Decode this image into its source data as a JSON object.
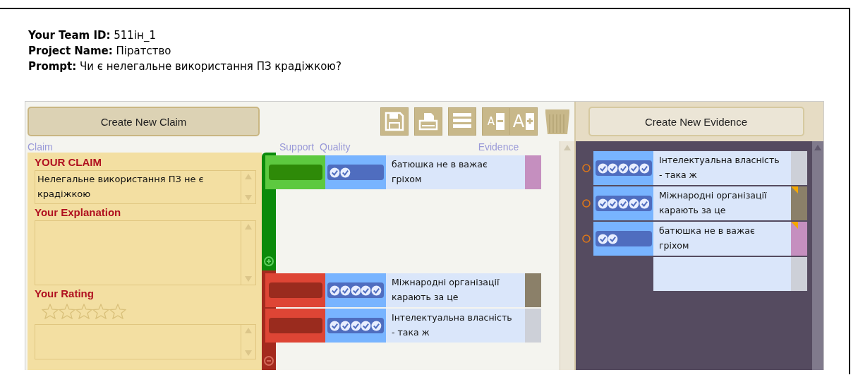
{
  "header": [
    {
      "label": "Your Team ID:",
      "value": "511ін_1"
    },
    {
      "label": "Project Name:",
      "value": "Піратство"
    },
    {
      "label": "Prompt:",
      "value": "Чи є нелегальне використання ПЗ крадіжкою?"
    }
  ],
  "claim_panel": {
    "create_button": "Create New Claim",
    "column_label": "Claim",
    "title": "YOUR CLAIM",
    "claim": "Нелегальне використання ПЗ не є крадіжкою",
    "explanation_label": "Your Explanation",
    "rating_label": "Your Rating",
    "stars": 0
  },
  "toolbar": [
    {
      "kind": "save"
    },
    {
      "kind": "print"
    },
    {
      "kind": "list"
    },
    {
      "kind": "font-smaller",
      "label": "A"
    },
    {
      "kind": "font-larger",
      "label": "A"
    },
    {
      "kind": "trash"
    }
  ],
  "columns": [
    "Support",
    "Quality",
    "Evidence"
  ],
  "links": [
    {
      "kind": "support",
      "level": 0.4,
      "text": "батюшка не в важає гріхом",
      "color": "#c58fbf"
    },
    {
      "kind": "oppose",
      "level": 1,
      "text": "Міжнародні організації карають за це",
      "color": "#8b8069"
    },
    {
      "kind": "oppose",
      "level": 1,
      "text": "Інтелектуальна власність - така ж",
      "color": "#cdd0d8"
    }
  ],
  "evidence_panel": {
    "create_button": "Create New Evidence",
    "items": [
      {
        "kind": "item",
        "level": 1,
        "text": "Інтелектуальна власність - така ж",
        "color": "#cdd0d8",
        "flagged": false
      },
      {
        "kind": "item",
        "level": 1,
        "text": "Міжнародні організації карають за це",
        "color": "#8b8069",
        "flagged": true
      },
      {
        "kind": "item",
        "level": 0.4,
        "text": "батюшка не в важає гріхом",
        "color": "#c58fbf",
        "flagged": true
      },
      {
        "kind": "blank",
        "color": "#cdd0d8",
        "flagged": false
      }
    ]
  }
}
